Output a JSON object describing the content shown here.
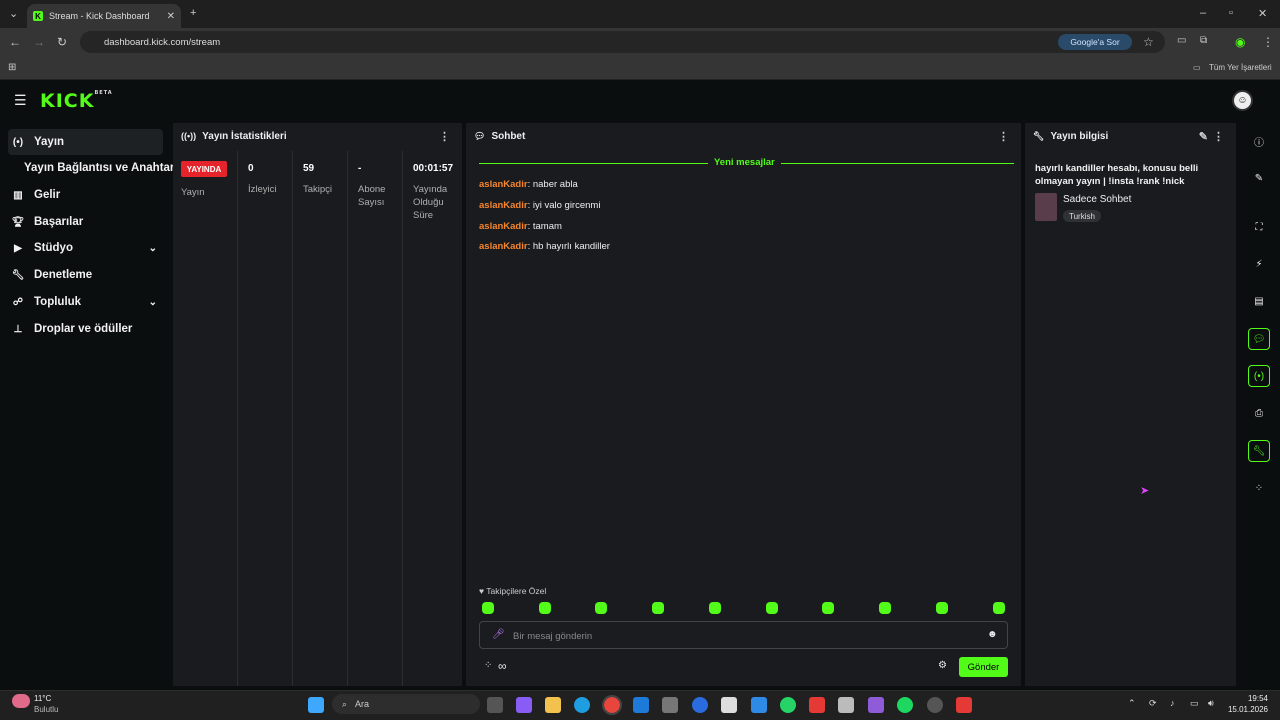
{
  "browser": {
    "tab_title": "Stream - Kick Dashboard",
    "url": "dashboard.kick.com/stream",
    "google_sor": "Google'a Sor",
    "bookmarks": "Tüm Yer İşaretleri"
  },
  "kick": {
    "logo": "KICK",
    "logo_badge": "BETA"
  },
  "sidebar": {
    "items": [
      {
        "label": "Yayın"
      },
      {
        "label": "Yayın Bağlantısı ve Anahtarı"
      },
      {
        "label": "Gelir"
      },
      {
        "label": "Başarılar"
      },
      {
        "label": "Stüdyo"
      },
      {
        "label": "Denetleme"
      },
      {
        "label": "Topluluk"
      },
      {
        "label": "Droplar ve ödüller"
      }
    ]
  },
  "stats": {
    "title": "Yayın İstatistikleri",
    "live_badge": "YAYINDA",
    "stream_label": "Yayın",
    "viewers_value": "0",
    "viewers_label": "İzleyici",
    "followers_value": "59",
    "followers_label": "Takipçi",
    "subs_value": "-",
    "subs_label": "Abone Sayısı",
    "uptime_value": "00:01:57",
    "uptime_label": "Yayında Olduğu Süre"
  },
  "chat": {
    "title": "Sohbet",
    "new_messages": "Yeni mesajlar",
    "messages": [
      {
        "user": "aslanKadir",
        "text": ": naber abla"
      },
      {
        "user": "aslanKadir",
        "text": ": iyi valo gircenmi"
      },
      {
        "user": "aslanKadir",
        "text": ": tamam"
      },
      {
        "user": "aslanKadir",
        "text": ": hb hayırlı kandiller"
      }
    ],
    "followers_only": "Takipçilere Özel",
    "input_placeholder": "Bir mesaj gönderin",
    "send_label": "Gönder"
  },
  "stream_info": {
    "title": "Yayın bilgisi",
    "stream_title": "hayırlı kandiller hesabı, konusu belli olmayan yayın | !insta !rank !nick",
    "category": "Sadece Sohbet",
    "language": "Turkish"
  },
  "taskbar": {
    "weather_temp": "11°C",
    "weather_desc": "Bulutlu",
    "search": "Ara",
    "time": "19:54",
    "date": "15.01.2026"
  },
  "colors": {
    "accent": "#53fc18",
    "live": "#e5232a",
    "username": "#f5862e"
  }
}
